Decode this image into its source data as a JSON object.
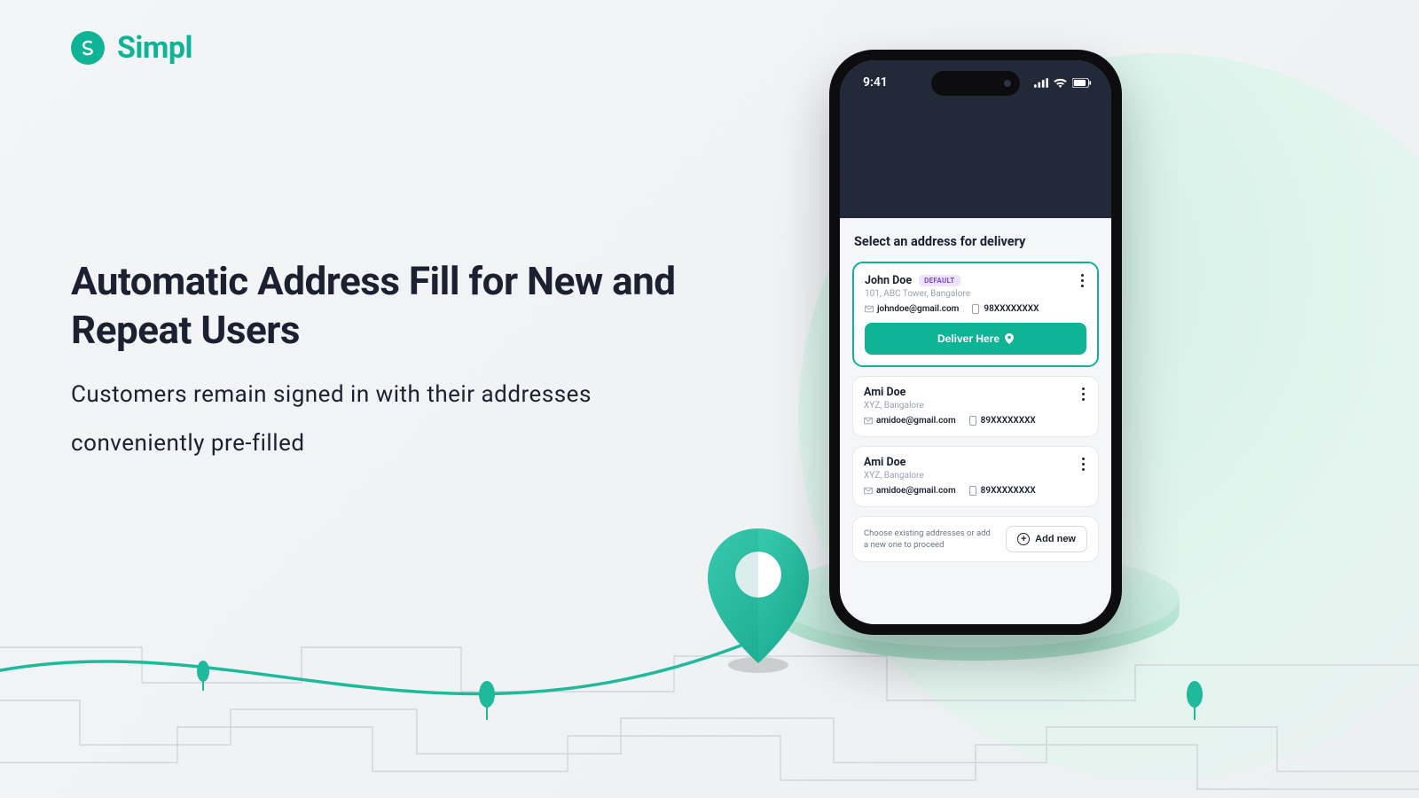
{
  "brand": {
    "name": "Simpl"
  },
  "headline": "Automatic Address Fill for New and Repeat Users",
  "subtitle": "Customers remain signed in with their addresses conveniently pre-filled",
  "phone": {
    "clock": "9:41",
    "sheet_title": "Select an address for delivery",
    "addresses": [
      {
        "name": "John Doe",
        "is_default": true,
        "default_label": "DEFAULT",
        "line": "101, ABC Tower, Bangalore",
        "email": "johndoe@gmail.com",
        "phone": "98XXXXXXXX",
        "selected": true
      },
      {
        "name": "Ami Doe",
        "is_default": false,
        "line": "XYZ, Bangalore",
        "email": "amidoe@gmail.com",
        "phone": "89XXXXXXXX",
        "selected": false
      },
      {
        "name": "Ami Doe",
        "is_default": false,
        "line": "XYZ, Bangalore",
        "email": "amidoe@gmail.com",
        "phone": "89XXXXXXXX",
        "selected": false
      }
    ],
    "deliver_label": "Deliver Here",
    "add_hint": "Choose existing addresses or add a new one to proceed",
    "add_label": "Add new"
  }
}
